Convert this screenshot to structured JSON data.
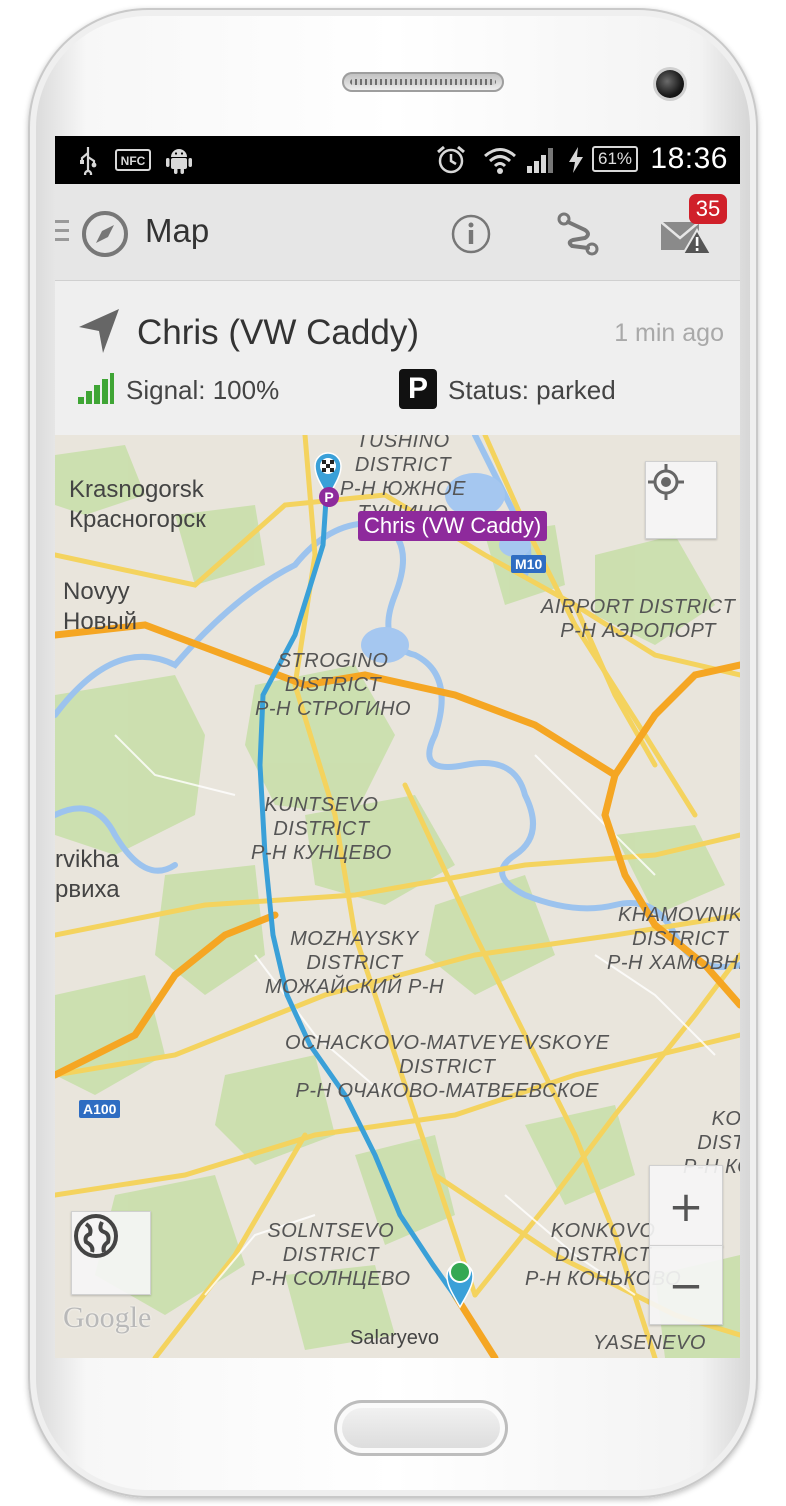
{
  "status_bar": {
    "time": "18:36",
    "battery_percent": "61%",
    "left_icons": [
      "usb-icon",
      "nfc-icon",
      "android-icon"
    ],
    "right_icons": [
      "alarm-icon",
      "wifi-icon",
      "cell-signal-icon",
      "charging-icon",
      "battery-icon"
    ]
  },
  "toolbar": {
    "title": "Map",
    "notification_count": "35",
    "actions": [
      "info-icon",
      "route-icon",
      "messages-alert-icon"
    ]
  },
  "vehicle_panel": {
    "name": "Chris (VW Caddy)",
    "last_seen": "1 min ago",
    "signal": "Signal: 100%",
    "status": "Status: parked",
    "parking_symbol": "P"
  },
  "map": {
    "marker_callout": "Chris (VW Caddy)",
    "attribution": "Google",
    "zoom_in": "+",
    "zoom_out": "−",
    "road_shields": {
      "m10": "M10",
      "a100": "A100"
    },
    "labels": {
      "tushino_a": "TUSHINO",
      "tushino_b": "DISTRICT",
      "tushino_c": "Р-Н ЮЖНОЕ",
      "tushino_d": "ТУШИНО",
      "krasnogorsk_en": "Krasnogorsk",
      "krasnogorsk_ru": "Красногорск",
      "novyy_en": "Novyy",
      "novyy_ru": "Новый",
      "airport_a": "AIRPORT DISTRICT",
      "airport_b": "Р-Н АЭРОПОРТ",
      "strogino_a": "STROGINO",
      "strogino_b": "DISTRICT",
      "strogino_c": "Р-Н СТРОГИНО",
      "kuntsevo_a": "KUNTSEVO",
      "kuntsevo_b": "DISTRICT",
      "kuntsevo_c": "Р-Н КУНЦЕВО",
      "rvikha_en": "rvikha",
      "rvikha_ru": "рвиха",
      "khamovniki_a": "KHAMOVNIK",
      "khamovniki_b": "DISTRICT",
      "khamovniki_c": "Р-Н ХАМОВНИ",
      "mozhaysky_a": "MOZHAYSKY",
      "mozhaysky_b": "DISTRICT",
      "mozhaysky_c": "МОЖАЙСКИЙ Р-Н",
      "ochakovo_a": "OCHACKOVO-MATVEYEVSKOYE",
      "ochakovo_b": "DISTRICT",
      "ochakovo_c": "Р-Н ОЧАКОВО-МАТВЕЕВСКОЕ",
      "kotl_a": "KOTL",
      "kotl_b": "DISTRI",
      "kotl_c": "Р-Н КОТ",
      "solntsevo_a": "SOLNTSEVO",
      "solntsevo_b": "DISTRICT",
      "solntsevo_c": "Р-Н СОЛНЦЕВО",
      "konkovo_a": "KONKOVO",
      "konkovo_b": "DISTRICT",
      "konkovo_c": "Р-Н КОНЬКОВО",
      "yasenevo": "YASENEVO",
      "salaryevo": "Salaryevo"
    }
  },
  "colors": {
    "route": "#3aa0d8",
    "major_road": "#f5a623",
    "minor_road": "#f4d35e",
    "water": "#a5c7f0",
    "park": "#c7dfa9",
    "marker_parked": "#8e2a9c",
    "marker_end": "#3aa0d8",
    "badge": "#d0202a",
    "signal": "#3fa535"
  }
}
